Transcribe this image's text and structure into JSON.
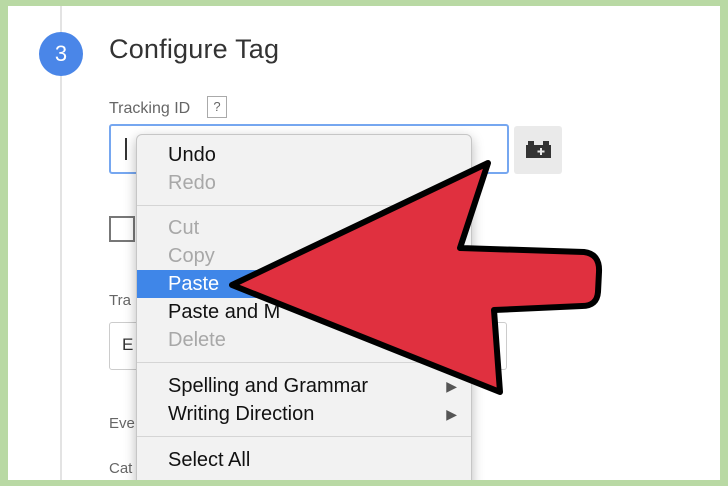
{
  "step": {
    "number": "3",
    "title": "Configure Tag"
  },
  "tracking_field": {
    "label": "Tracking ID",
    "help": "?"
  },
  "partial_labels": {
    "track_type": "Tra",
    "select_value": "E",
    "event": "Eve",
    "category": "Cat"
  },
  "context_menu": {
    "undo": "Undo",
    "redo": "Redo",
    "cut": "Cut",
    "copy": "Copy",
    "paste": "Paste",
    "paste_and_match": "Paste and M",
    "delete": "Delete",
    "spelling": "Spelling and Grammar",
    "writing_direction": "Writing Direction",
    "select_all": "Select All"
  },
  "icons": {
    "macro": "macro-brick-icon",
    "submenu": "triangle-right-icon",
    "select": "updown-arrows-icon",
    "annotation": "red-arrow-icon"
  },
  "colors": {
    "accent": "#4a86e8",
    "highlight": "#3f86e8",
    "arrow_fill": "#e0303f",
    "frame": "#b9d9a4"
  }
}
